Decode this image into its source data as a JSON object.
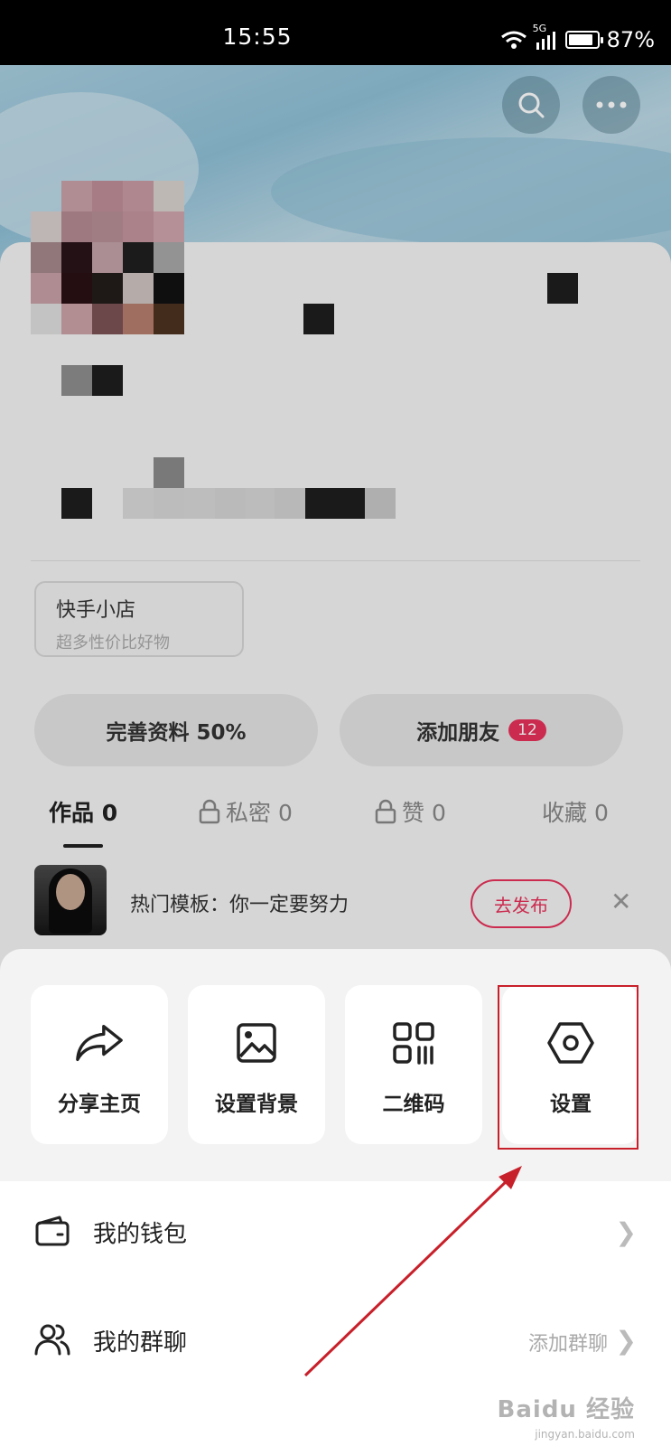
{
  "status_bar": {
    "time": "15:55",
    "network": "5G",
    "battery": "87%",
    "battery_level": 0.87
  },
  "header": {
    "search_icon": "search-icon",
    "more_icon": "more-icon"
  },
  "shop": {
    "title": "快手小店",
    "subtitle": "超多性价比好物"
  },
  "profile_actions": {
    "complete_profile": "完善资料 50%",
    "add_friends": "添加朋友",
    "add_friends_badge": "12"
  },
  "tabs": [
    {
      "label": "作品 0",
      "locked": false
    },
    {
      "label": "私密 0",
      "locked": true
    },
    {
      "label": "赞 0",
      "locked": true
    },
    {
      "label": "收藏 0",
      "locked": false
    }
  ],
  "template": {
    "text": "热门模板：你一定要努力",
    "publish": "去发布"
  },
  "sheet": {
    "actions": [
      {
        "label": "分享主页",
        "icon": "share-icon"
      },
      {
        "label": "设置背景",
        "icon": "image-icon"
      },
      {
        "label": "二维码",
        "icon": "qrcode-icon"
      },
      {
        "label": "设置",
        "icon": "settings-icon"
      }
    ],
    "list": [
      {
        "label": "我的钱包",
        "extra": "",
        "icon": "wallet-icon"
      },
      {
        "label": "我的群聊",
        "extra": "添加群聊",
        "icon": "group-icon"
      }
    ]
  },
  "watermark": {
    "text": "Baidu 经验",
    "sub": "jingyan.baidu.com"
  }
}
